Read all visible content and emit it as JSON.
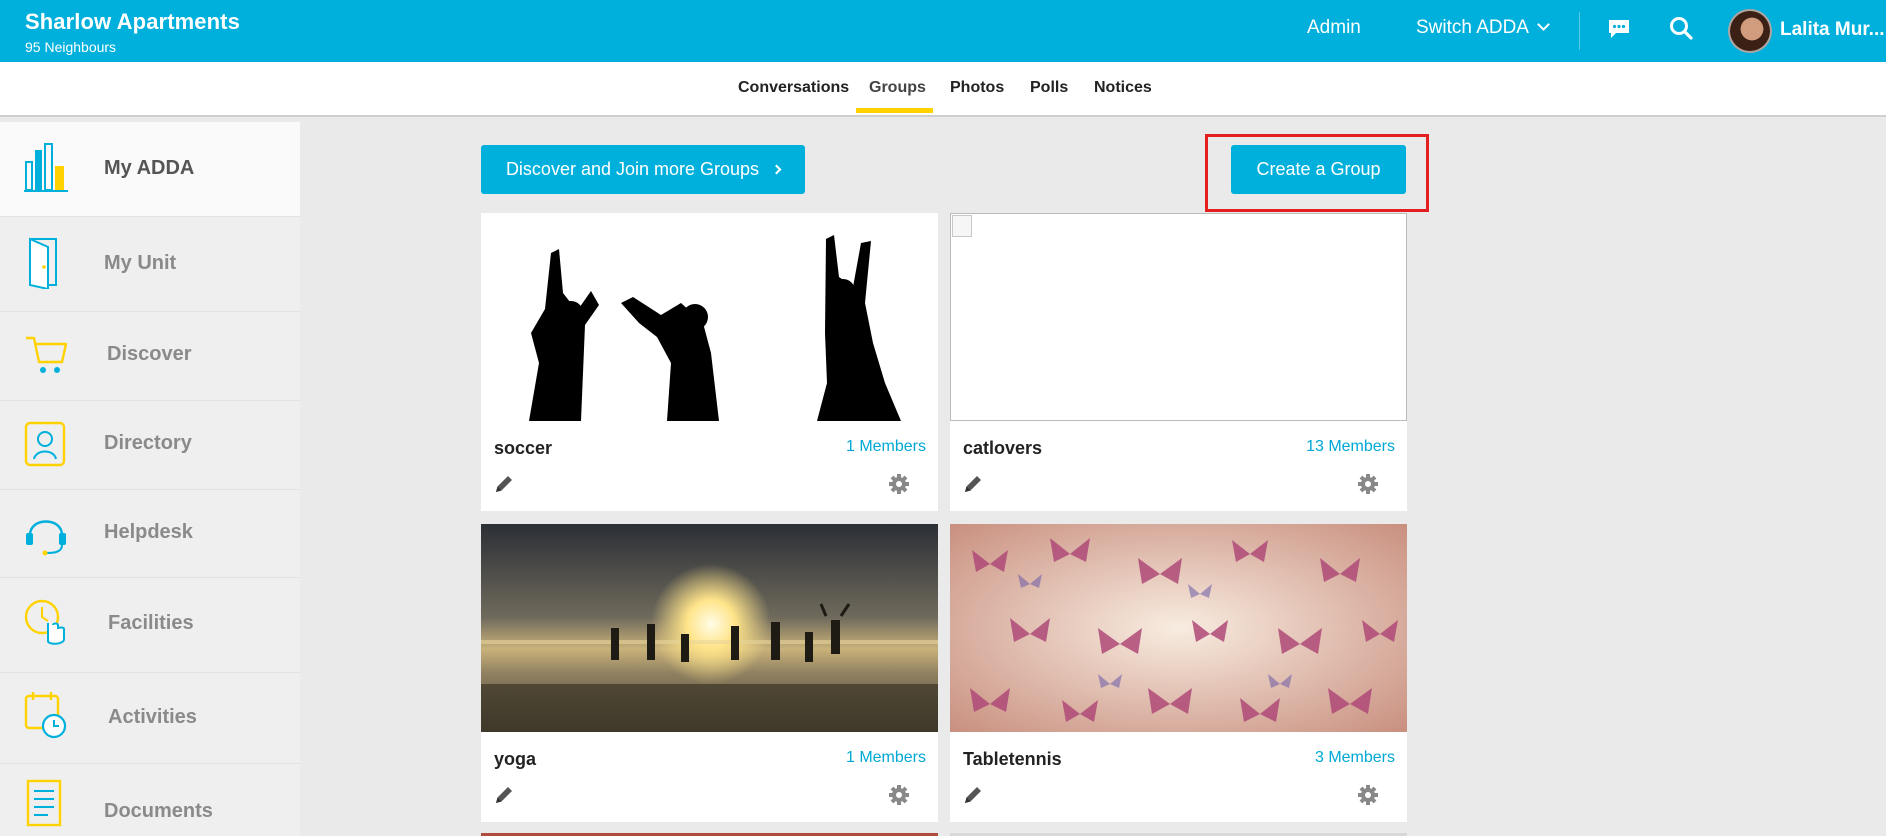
{
  "header": {
    "app_title": "Sharlow Apartments",
    "subtitle": "95 Neighbours",
    "admin_label": "Admin",
    "switch_label": "Switch ADDA",
    "user_name": "Lalita Mur..."
  },
  "tabs": [
    {
      "label": "Conversations"
    },
    {
      "label": "Groups"
    },
    {
      "label": "Photos"
    },
    {
      "label": "Polls"
    },
    {
      "label": "Notices"
    }
  ],
  "active_tab": "Groups",
  "sidebar": {
    "items": [
      {
        "label": "My ADDA",
        "icon": "building-icon"
      },
      {
        "label": "My Unit",
        "icon": "door-icon"
      },
      {
        "label": "Discover",
        "icon": "cart-icon"
      },
      {
        "label": "Directory",
        "icon": "contact-book-icon"
      },
      {
        "label": "Helpdesk",
        "icon": "headset-icon"
      },
      {
        "label": "Facilities",
        "icon": "clock-hand-icon"
      },
      {
        "label": "Activities",
        "icon": "calendar-clock-icon"
      },
      {
        "label": "Documents",
        "icon": "document-icon"
      }
    ]
  },
  "actions": {
    "discover_label": "Discover and Join more Groups",
    "create_label": "Create a Group"
  },
  "groups": [
    {
      "name": "soccer",
      "members": "1 Members"
    },
    {
      "name": "catlovers",
      "members": "13 Members"
    },
    {
      "name": "yoga",
      "members": "1 Members"
    },
    {
      "name": "Tabletennis",
      "members": "3 Members"
    }
  ],
  "colors": {
    "brand": "#00b0dc",
    "accent_yellow": "#ffd200",
    "highlight_red": "#e41f1f"
  }
}
